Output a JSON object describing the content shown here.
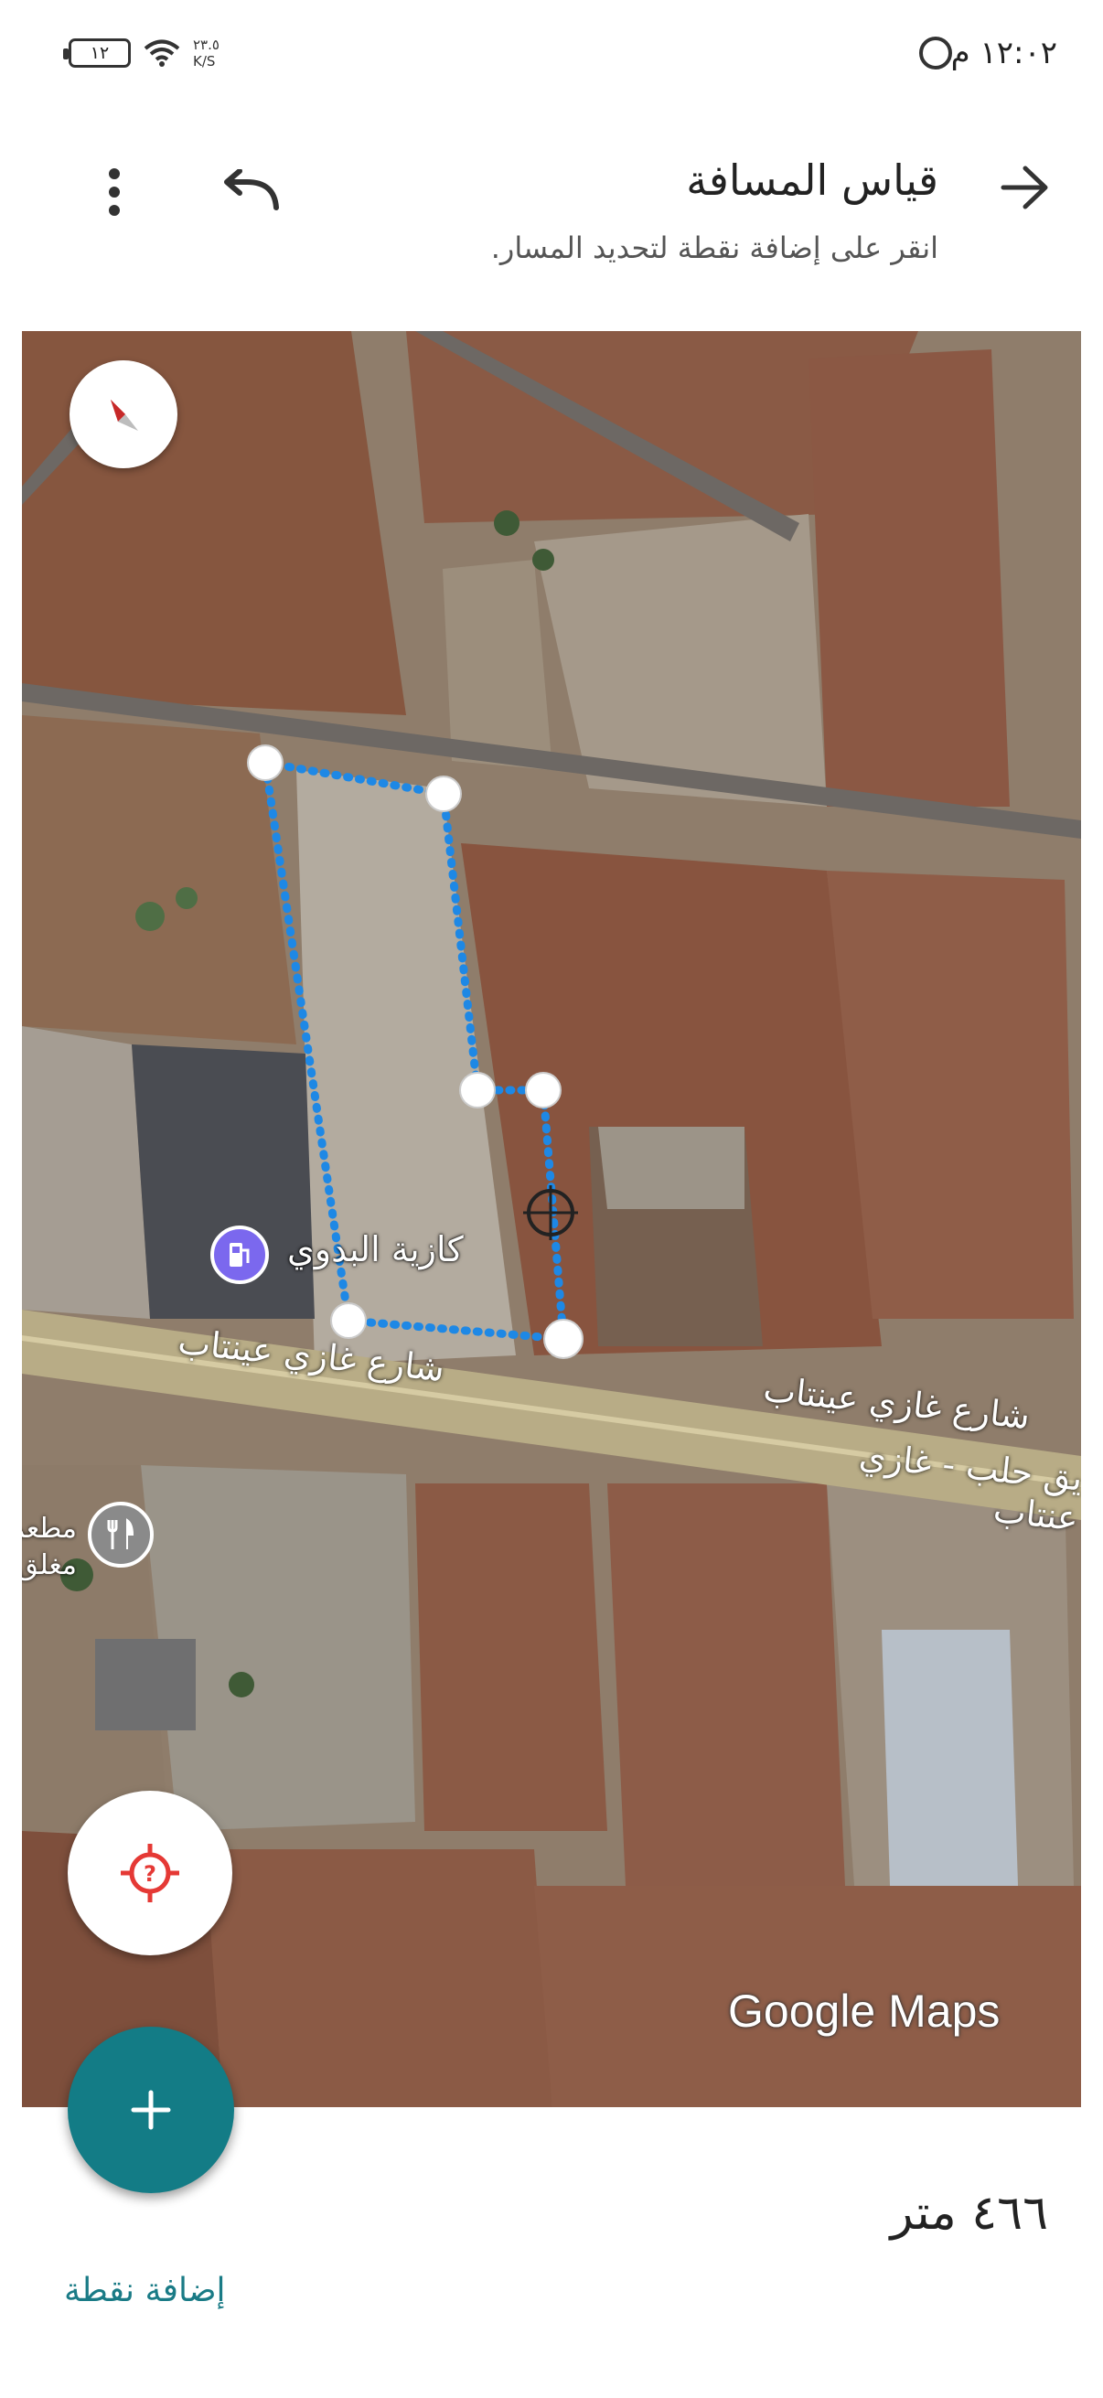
{
  "status_bar": {
    "time": "١٢:٠٢ م",
    "battery": "١٢",
    "network_speed_value": "٢٣.٥",
    "network_speed_unit": "K/S"
  },
  "header": {
    "title": "قياس المسافة",
    "subtitle": "انقر على إضافة نقطة لتحديد المسار."
  },
  "map": {
    "poi_name": "كازية البدوي",
    "road_label_1": "شارع غازي عينتاب",
    "road_label_2": "شارع غازي عينتاب",
    "road_label_3": "يق حلب - غازي عنتاب",
    "restaurant_label": "مطعم مغلق",
    "logo": "Google Maps",
    "accent_color": "#1e88e5"
  },
  "measurement": {
    "distance": "٤٦٦ متر",
    "add_point": "إضافة نقطة"
  }
}
